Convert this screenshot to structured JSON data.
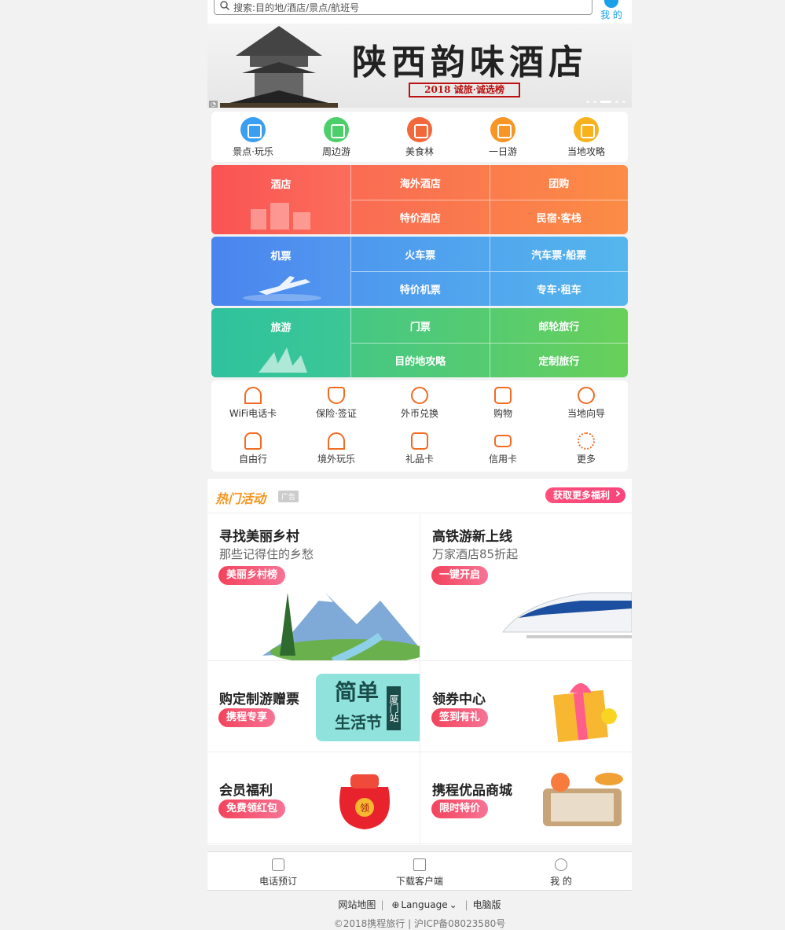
{
  "search": {
    "placeholder": "搜索:目的地/酒店/景点/航班号"
  },
  "header": {
    "me_label": "我 的"
  },
  "banner": {
    "title": "陕西韵味酒店",
    "subtitle": "2018 诚旅·诚选榜"
  },
  "quick_nav": [
    {
      "label": "景点·玩乐",
      "color": "#3a9ff0"
    },
    {
      "label": "周边游",
      "color": "#4ccf6a"
    },
    {
      "label": "美食林",
      "color": "#f3683a"
    },
    {
      "label": "一日游",
      "color": "#f79624"
    },
    {
      "label": "当地攻略",
      "color": "#f7b21e"
    }
  ],
  "grids": [
    {
      "main": "酒店",
      "cells": [
        "海外酒店",
        "团购",
        "特价酒店",
        "民宿·客栈"
      ],
      "from": "#fa5b5b",
      "to": "#fb8c45"
    },
    {
      "main": "机票",
      "cells": [
        "火车票",
        "汽车票·船票",
        "特价机票",
        "专车·租车"
      ],
      "from": "#4a89ee",
      "to": "#55b6ed"
    },
    {
      "main": "旅游",
      "cells": [
        "门票",
        "邮轮旅行",
        "目的地攻略",
        "定制旅行"
      ],
      "from": "#33c39a",
      "to": "#68d05a"
    }
  ],
  "services": [
    {
      "label": "WiFi电话卡",
      "icon": "wifi-icon"
    },
    {
      "label": "保险·签证",
      "icon": "shield-icon"
    },
    {
      "label": "外币兑换",
      "icon": "currency-icon"
    },
    {
      "label": "购物",
      "icon": "shopping-bag-icon"
    },
    {
      "label": "当地向导",
      "icon": "guide-icon"
    },
    {
      "label": "自由行",
      "icon": "luggage-icon"
    },
    {
      "label": "境外玩乐",
      "icon": "tower-icon"
    },
    {
      "label": "礼品卡",
      "icon": "gift-card-icon"
    },
    {
      "label": "信用卡",
      "icon": "credit-card-icon"
    },
    {
      "label": "更多",
      "icon": "more-icon"
    }
  ],
  "hot": {
    "title": "热门活动",
    "ad": "广告",
    "more": "获取更多福利",
    "tiles": [
      {
        "title": "寻找美丽乡村",
        "sub": "那些记得住的乡愁",
        "btn": "美丽乡村榜"
      },
      {
        "title": "高铁游新上线",
        "sub": "万家酒店85折起",
        "btn": "一键开启"
      },
      {
        "title": "购定制游赠票",
        "sub": "",
        "btn": "携程专享",
        "art_big": "简单",
        "art_small": "生活节",
        "art_tag": "厦门站"
      },
      {
        "title": "领券中心",
        "sub": "",
        "btn": "签到有礼"
      },
      {
        "title": "会员福利",
        "sub": "",
        "btn": "免费领红包",
        "art_tag": "领"
      },
      {
        "title": "携程优品商城",
        "sub": "",
        "btn": "限时特价"
      }
    ]
  },
  "bottom_nav": [
    {
      "label": "电话预订",
      "icon": "phone-icon"
    },
    {
      "label": "下载客户端",
      "icon": "download-icon"
    },
    {
      "label": "我 的",
      "icon": "user-icon"
    }
  ],
  "footer": {
    "links": [
      "网站地图",
      "Language",
      "电脑版"
    ],
    "copyright": "©2018携程旅行 | 沪ICP备08023580号"
  }
}
